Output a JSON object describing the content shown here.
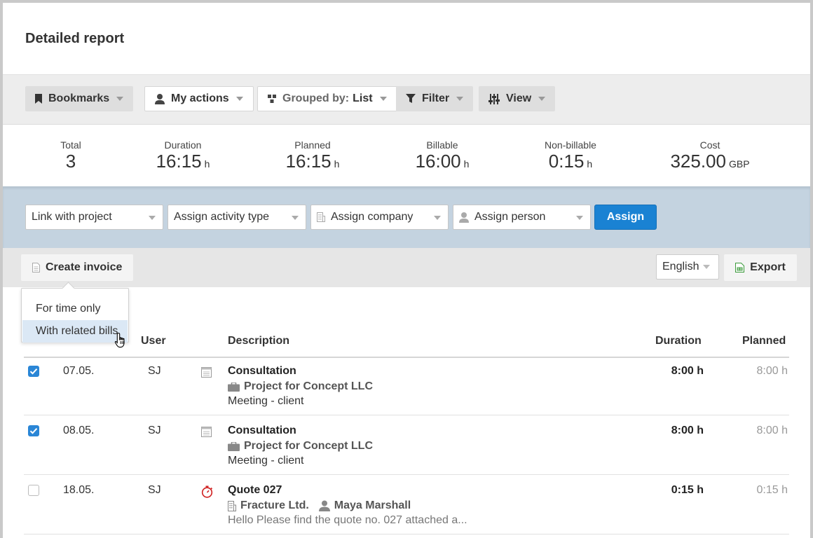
{
  "page": {
    "title": "Detailed report"
  },
  "toolbar": {
    "bookmarks": "Bookmarks",
    "my_actions": "My actions",
    "grouped_by_label": "Grouped by:",
    "grouped_by_value": "List",
    "filter": "Filter",
    "view": "View"
  },
  "stats": [
    {
      "label": "Total",
      "value": "3",
      "unit": ""
    },
    {
      "label": "Duration",
      "value": "16:15",
      "unit": "h"
    },
    {
      "label": "Planned",
      "value": "16:15",
      "unit": "h"
    },
    {
      "label": "Billable",
      "value": "16:00",
      "unit": "h"
    },
    {
      "label": "Non-billable",
      "value": "0:15",
      "unit": "h"
    },
    {
      "label": "Cost",
      "value": "325.00",
      "unit": "GBP"
    }
  ],
  "assign_bar": {
    "link_project": "Link with project",
    "activity_type": "Assign activity type",
    "company": "Assign company",
    "person": "Assign person",
    "assign_button": "Assign"
  },
  "action_bar": {
    "create_invoice": "Create invoice",
    "language": "English",
    "export": "Export"
  },
  "invoice_menu": {
    "items": [
      "For time only",
      "With related bills"
    ],
    "hovered": "With related bills"
  },
  "table": {
    "columns": {
      "user": "User",
      "description": "Description",
      "duration": "Duration",
      "planned": "Planned"
    },
    "rows": [
      {
        "checked": true,
        "date": "07.05.",
        "user": "SJ",
        "type_icon": "calendar-icon",
        "title": "Consultation",
        "subtitle": "Project for Concept LLC",
        "subtitle_icon": "briefcase-icon",
        "note": "Meeting - client",
        "duration": "8:00 h",
        "planned": "8:00 h"
      },
      {
        "checked": true,
        "date": "08.05.",
        "user": "SJ",
        "type_icon": "calendar-icon",
        "title": "Consultation",
        "subtitle": "Project for Concept LLC",
        "subtitle_icon": "briefcase-icon",
        "note": "Meeting - client",
        "duration": "8:00 h",
        "planned": "8:00 h"
      },
      {
        "checked": false,
        "date": "18.05.",
        "user": "SJ",
        "type_icon": "stopwatch-icon",
        "title": "Quote 027",
        "subtitle": "Fracture Ltd.",
        "subtitle_icon": "building-icon",
        "subtitle_person": "Maya Marshall",
        "note": "Hello   Please find the quote no. 027 attached a...",
        "duration": "0:15 h",
        "planned": "0:15 h"
      }
    ]
  },
  "colors": {
    "accent_blue": "#1a82d3",
    "assign_bar_bg": "#c4d3e0",
    "toolbar_bg": "#ededed",
    "stopwatch_red": "#d02020",
    "export_green": "#3a9a3a"
  }
}
